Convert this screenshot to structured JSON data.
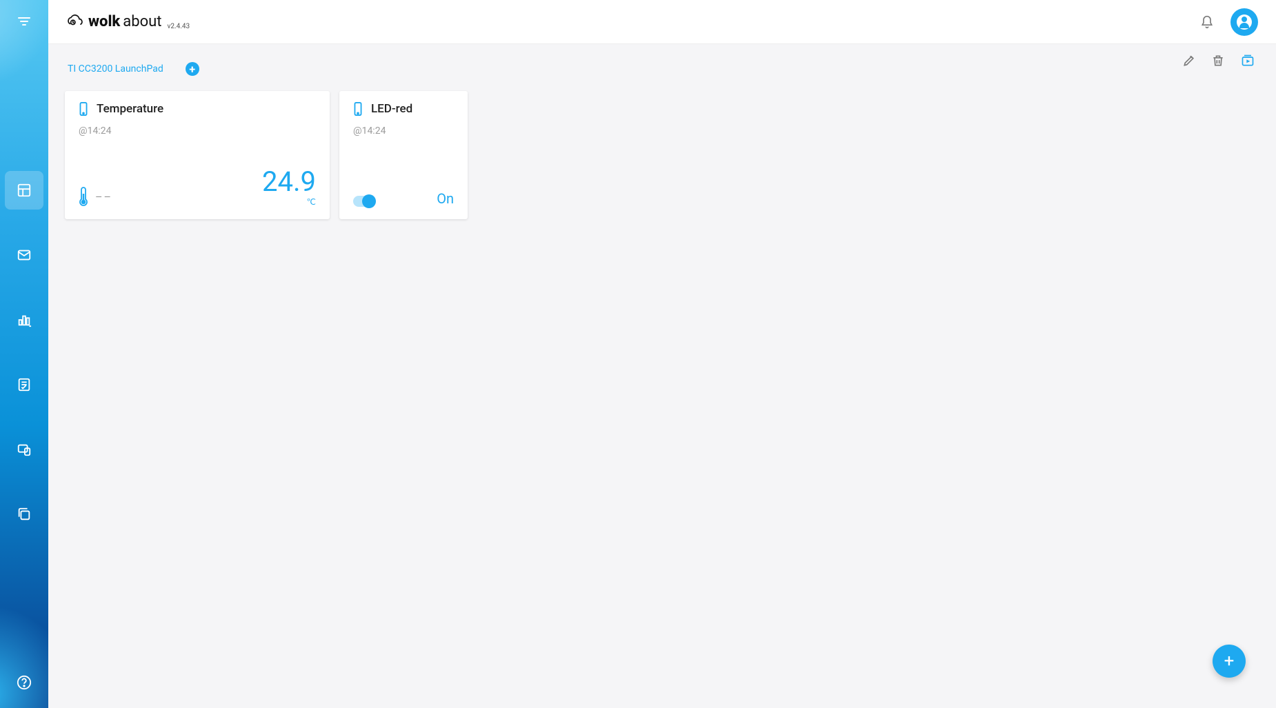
{
  "brand": {
    "name_bold": "wolk",
    "name_light": "about",
    "version": "v2.4.43"
  },
  "tabs": {
    "active": "TI CC3200 LaunchPad"
  },
  "toolbar": {
    "edit": "edit",
    "delete": "delete",
    "play": "play"
  },
  "cards": {
    "temperature": {
      "title": "Temperature",
      "time": "@14:24",
      "dash": "––",
      "value": "24.9",
      "unit": "℃"
    },
    "led": {
      "title": "LED-red",
      "time": "@14:24",
      "state": "On"
    }
  },
  "colors": {
    "accent": "#1ea9f0"
  }
}
